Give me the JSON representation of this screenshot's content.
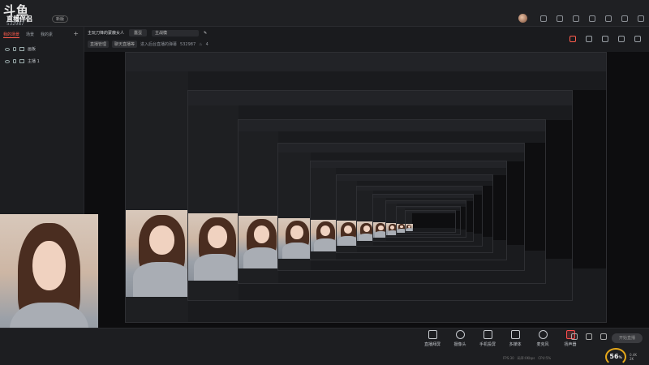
{
  "app": {
    "logo_text": "斗鱼",
    "logo_sub": "直播伴侣",
    "user_id": "532987",
    "version_badge": "新版"
  },
  "sidebar": {
    "tabs": [
      {
        "label": "我的场景",
        "active": true
      },
      {
        "label": "场景",
        "active": false
      },
      {
        "label": "我的素",
        "active": false
      }
    ],
    "add_symbol": "+",
    "scenes": [
      {
        "label": "画板"
      },
      {
        "label": "主播 1"
      }
    ]
  },
  "room": {
    "title": "主玩刀锋的蒙蔽女人",
    "category_tag": "蠢蛋",
    "rename_input": "主战模",
    "topic_label": "直播管理",
    "topic_value": "聊天直播等",
    "online_text": "进入后台直播的弹幕",
    "viewer_id": "532987",
    "likes": "4"
  },
  "toolbar": {
    "items": [
      {
        "label": "直播拜屏",
        "icon": "screen-share-icon"
      },
      {
        "label": "摄像头",
        "icon": "camera-icon"
      },
      {
        "label": "手机投屏",
        "icon": "phone-cast-icon"
      },
      {
        "label": "多媒体",
        "icon": "media-icon"
      },
      {
        "label": "麦克风",
        "icon": "mic-icon"
      },
      {
        "label": "扬声器",
        "icon": "speaker-icon"
      }
    ],
    "live_button": "开始直播",
    "stats": [
      "FPS:30",
      "码率:0Kbps",
      "CPU:5%"
    ],
    "gauge_value": "56",
    "gauge_unit": "%",
    "speed_up": "0.4K",
    "speed_down": "2K"
  },
  "colors": {
    "accent": "#ff5d4d",
    "gauge": "#e6a81a",
    "background": "#1a1b1e"
  }
}
